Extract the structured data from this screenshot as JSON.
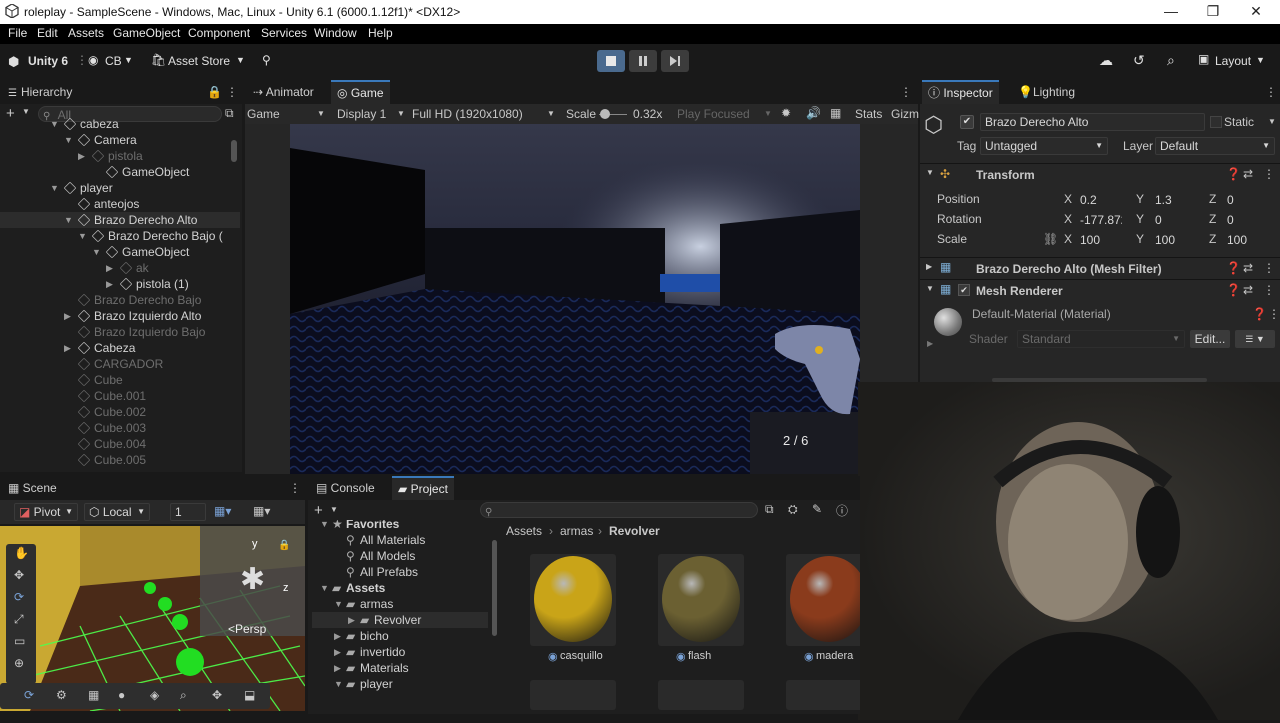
{
  "window": {
    "title": "roleplay - SampleScene - Windows, Mac, Linux - Unity 6.1 (6000.1.12f1)* <DX12>",
    "minimize": "—",
    "maximize": "❐",
    "close": "✕"
  },
  "menu": [
    "File",
    "Edit",
    "Assets",
    "GameObject",
    "Component",
    "Services",
    "Window",
    "Help"
  ],
  "toolbar": {
    "unity_label": "Unity 6",
    "account": "CB",
    "asset_store": "Asset Store",
    "layout": "Layout"
  },
  "hierarchy": {
    "tab": "Hierarchy",
    "search_placeholder": "All",
    "items": [
      {
        "label": "cabeza",
        "depth": 4,
        "dim": false,
        "arrow": "▼",
        "sel": false
      },
      {
        "label": "Camera",
        "depth": 5,
        "dim": false,
        "arrow": "▼",
        "sel": false
      },
      {
        "label": "pistola",
        "depth": 6,
        "dim": true,
        "arrow": "▶",
        "sel": false
      },
      {
        "label": "GameObject",
        "depth": 7,
        "dim": false,
        "arrow": "",
        "sel": false
      },
      {
        "label": "player",
        "depth": 4,
        "dim": false,
        "arrow": "▼",
        "sel": false
      },
      {
        "label": "anteojos",
        "depth": 5,
        "dim": false,
        "arrow": "",
        "sel": false
      },
      {
        "label": "Brazo Derecho Alto",
        "depth": 5,
        "dim": false,
        "arrow": "▼",
        "sel": true
      },
      {
        "label": "Brazo Derecho Bajo (",
        "depth": 6,
        "dim": false,
        "arrow": "▼",
        "sel": false
      },
      {
        "label": "GameObject",
        "depth": 7,
        "dim": false,
        "arrow": "▼",
        "sel": false
      },
      {
        "label": "ak",
        "depth": 8,
        "dim": true,
        "arrow": "▶",
        "sel": false
      },
      {
        "label": "pistola (1)",
        "depth": 8,
        "dim": false,
        "arrow": "▶",
        "sel": false
      },
      {
        "label": "Brazo Derecho Bajo",
        "depth": 5,
        "dim": true,
        "arrow": "",
        "sel": false
      },
      {
        "label": "Brazo Izquierdo Alto",
        "depth": 5,
        "dim": false,
        "arrow": "▶",
        "sel": false
      },
      {
        "label": "Brazo Izquierdo Bajo",
        "depth": 5,
        "dim": true,
        "arrow": "",
        "sel": false
      },
      {
        "label": "Cabeza",
        "depth": 5,
        "dim": false,
        "arrow": "▶",
        "sel": false
      },
      {
        "label": "CARGADOR",
        "depth": 5,
        "dim": true,
        "arrow": "",
        "sel": false
      },
      {
        "label": "Cube",
        "depth": 5,
        "dim": true,
        "arrow": "",
        "sel": false
      },
      {
        "label": "Cube.001",
        "depth": 5,
        "dim": true,
        "arrow": "",
        "sel": false
      },
      {
        "label": "Cube.002",
        "depth": 5,
        "dim": true,
        "arrow": "",
        "sel": false
      },
      {
        "label": "Cube.003",
        "depth": 5,
        "dim": true,
        "arrow": "",
        "sel": false
      },
      {
        "label": "Cube.004",
        "depth": 5,
        "dim": true,
        "arrow": "",
        "sel": false
      },
      {
        "label": "Cube.005",
        "depth": 5,
        "dim": true,
        "arrow": "",
        "sel": false
      }
    ]
  },
  "game": {
    "tabs": [
      "Animator",
      "Game"
    ],
    "mode": "Game",
    "display": "Display 1",
    "resolution": "Full HD (1920x1080)",
    "scale_label": "Scale",
    "scale_value": "0.32x",
    "play_focused": "Play Focused",
    "stats": "Stats",
    "gizmos": "Gizm",
    "ammo": "2 / 6"
  },
  "inspector": {
    "tabs": [
      "Inspector",
      "Lighting"
    ],
    "object_name": "Brazo Derecho Alto",
    "static_label": "Static",
    "tag_label": "Tag",
    "tag_value": "Untagged",
    "layer_label": "Layer",
    "layer_value": "Default",
    "transform": {
      "title": "Transform",
      "position": {
        "label": "Position",
        "x": "0.2",
        "y": "1.3",
        "z": "0"
      },
      "rotation": {
        "label": "Rotation",
        "x": "-177.872",
        "y": "0",
        "z": "0"
      },
      "scale": {
        "label": "Scale",
        "x": "100",
        "y": "100",
        "z": "100"
      }
    },
    "mesh_filter": "Brazo Derecho Alto (Mesh Filter)",
    "mesh_renderer": "Mesh Renderer",
    "material": "Default-Material (Material)",
    "shader_label": "Shader",
    "shader_value": "Standard",
    "edit_button": "Edit...",
    "axis": {
      "x": "X",
      "y": "Y",
      "z": "Z"
    }
  },
  "scene": {
    "tab": "Scene",
    "pivot": "Pivot",
    "local": "Local",
    "grid_value": "1",
    "persp": "<Persp",
    "gizmo_y": "y",
    "gizmo_z": "z"
  },
  "project": {
    "tabs": [
      "Console",
      "Project"
    ],
    "tree": [
      {
        "label": "Favorites",
        "depth": 0,
        "bold": true
      },
      {
        "label": "All Materials",
        "depth": 1,
        "bold": false
      },
      {
        "label": "All Models",
        "depth": 1,
        "bold": false
      },
      {
        "label": "All Prefabs",
        "depth": 1,
        "bold": false
      },
      {
        "label": "Assets",
        "depth": 0,
        "bold": true
      },
      {
        "label": "armas",
        "depth": 1,
        "bold": false
      },
      {
        "label": "Revolver",
        "depth": 2,
        "bold": false
      },
      {
        "label": "bicho",
        "depth": 1,
        "bold": false
      },
      {
        "label": "invertido",
        "depth": 1,
        "bold": false
      },
      {
        "label": "Materials",
        "depth": 1,
        "bold": false
      },
      {
        "label": "player",
        "depth": 1,
        "bold": false
      }
    ],
    "breadcrumb": [
      "Assets",
      "armas",
      "Revolver"
    ],
    "assets": [
      {
        "label": "casquillo",
        "color": "#c9a418"
      },
      {
        "label": "flash",
        "color": "#6b6032"
      },
      {
        "label": "madera",
        "color": "#8a3b1c"
      }
    ]
  }
}
